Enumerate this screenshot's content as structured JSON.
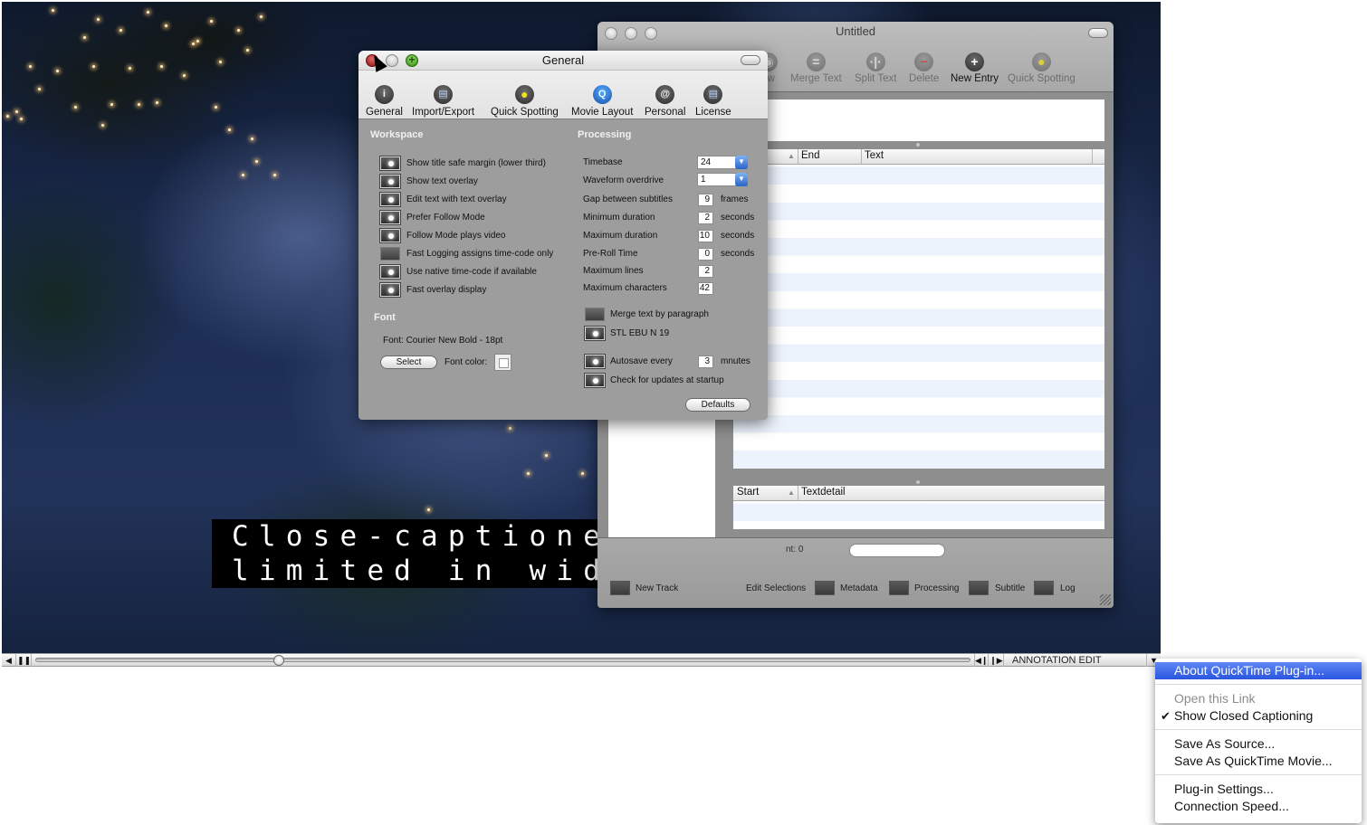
{
  "caption": {
    "lines": [
      "Close-captioned lines are",
      "limited in width to a maximum"
    ]
  },
  "document_window": {
    "title": "Untitled",
    "toolbar": [
      {
        "label": "ew",
        "icon": "view-icon",
        "state": "disabled"
      },
      {
        "label": "Merge Text",
        "icon": "merge-icon",
        "state": "disabled"
      },
      {
        "label": "Split Text",
        "icon": "split-icon",
        "state": "disabled"
      },
      {
        "label": "Delete",
        "icon": "minus-icon",
        "state": "disabled"
      },
      {
        "label": "New Entry",
        "icon": "plus-icon",
        "state": "enabled"
      },
      {
        "label": "Quick Spotting",
        "icon": "bulb-icon",
        "state": "disabled"
      }
    ],
    "main_table": {
      "columns": [
        "End",
        "Text"
      ],
      "rows": []
    },
    "detail_table": {
      "columns": [
        "Start",
        "Textdetail"
      ],
      "rows": []
    },
    "count_label": "nt: 0",
    "search": {
      "value": "",
      "placeholder": ""
    },
    "bottom_bar": [
      "New Track",
      "Edit Selections",
      "Metadata",
      "Processing",
      "Subtitle",
      "Log"
    ]
  },
  "prefs_window": {
    "title": "General",
    "toolbar": [
      {
        "label": "General",
        "icon": "info-icon"
      },
      {
        "label": "Import/Export",
        "icon": "document-icon"
      },
      {
        "label": "Quick Spotting",
        "icon": "bulb-icon"
      },
      {
        "label": "Movie Layout",
        "icon": "quicktime-icon"
      },
      {
        "label": "Personal",
        "icon": "at-icon"
      },
      {
        "label": "License",
        "icon": "license-icon"
      }
    ],
    "workspace": {
      "title": "Workspace",
      "options": [
        {
          "label": "Show title safe margin (lower third)",
          "checked": true
        },
        {
          "label": "Show text overlay",
          "checked": true
        },
        {
          "label": "Edit text with text overlay",
          "checked": true
        },
        {
          "label": "Prefer Follow Mode",
          "checked": true
        },
        {
          "label": "Follow Mode plays video",
          "checked": true
        },
        {
          "label": "Fast Logging assigns time-code only",
          "checked": false
        },
        {
          "label": "Use native time-code if available",
          "checked": true
        },
        {
          "label": "Fast overlay display",
          "checked": true
        }
      ]
    },
    "font": {
      "title": "Font",
      "description": "Font: Courier New Bold - 18pt",
      "select_label": "Select",
      "color_label": "Font color:",
      "color": "#ffffff"
    },
    "processing": {
      "title": "Processing",
      "timebase": {
        "label": "Timebase",
        "value": "24"
      },
      "waveform": {
        "label": "Waveform overdrive",
        "value": "1"
      },
      "fields": [
        {
          "label": "Gap between subtitles",
          "value": "9",
          "unit": "frames"
        },
        {
          "label": "Minimum duration",
          "value": "2",
          "unit": "seconds"
        },
        {
          "label": "Maximum duration",
          "value": "10",
          "unit": "seconds"
        },
        {
          "label": "Pre-Roll Time",
          "value": "0",
          "unit": "seconds"
        },
        {
          "label": "Maximum lines",
          "value": "2",
          "unit": ""
        },
        {
          "label": "Maximum characters",
          "value": "42",
          "unit": ""
        }
      ],
      "merge_text": {
        "label": "Merge text by paragraph",
        "checked": false
      },
      "stl": {
        "label": "STL EBU N 19",
        "checked": true
      },
      "autosave": {
        "label": "Autosave every",
        "value": "3",
        "unit": "mnutes",
        "checked": true
      },
      "updates": {
        "label": "Check for updates at startup",
        "checked": true
      },
      "defaults_label": "Defaults"
    }
  },
  "controller": {
    "volume_icon": "speaker-icon",
    "play_state": "playing",
    "progress": 0.26,
    "label": "ANNOTATION EDIT"
  },
  "context_menu": {
    "groups": [
      [
        {
          "label": "About QuickTime Plug-in...",
          "highlighted": true
        }
      ],
      [
        {
          "label": "Open this Link",
          "disabled": true
        },
        {
          "label": "Show Closed Captioning",
          "checked": true
        }
      ],
      [
        {
          "label": "Save As Source..."
        },
        {
          "label": "Save As QuickTime Movie..."
        }
      ],
      [
        {
          "label": "Plug-in Settings..."
        },
        {
          "label": "Connection Speed..."
        }
      ]
    ]
  }
}
